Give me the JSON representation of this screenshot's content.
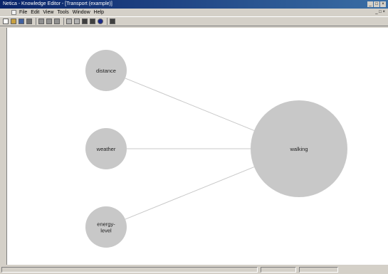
{
  "window": {
    "title": "Netica - Knowledge Editor - [Transport (example)]",
    "controls": [
      "_",
      "□",
      "×"
    ]
  },
  "menubar": {
    "items": [
      "File",
      "Edit",
      "View",
      "Tools",
      "Window",
      "Help"
    ],
    "mdi_controls": "_ □ ×"
  },
  "toolbar": {
    "buttons": [
      {
        "name": "new-icon",
        "color": "#ffffff"
      },
      {
        "name": "open-icon",
        "color": "#c8a040"
      },
      {
        "name": "save-icon",
        "color": "#4060a0"
      },
      {
        "name": "print-icon",
        "color": "#707070"
      },
      {
        "name": "separator"
      },
      {
        "name": "cut-icon",
        "color": "#909090"
      },
      {
        "name": "copy-icon",
        "color": "#909090"
      },
      {
        "name": "paste-icon",
        "color": "#909090"
      },
      {
        "name": "separator"
      },
      {
        "name": "node-icon",
        "color": "#b0b0b0"
      },
      {
        "name": "link-icon",
        "color": "#b0b0b0"
      },
      {
        "name": "arrow-left-icon",
        "color": "#404040"
      },
      {
        "name": "arrow-right-icon",
        "color": "#404040"
      },
      {
        "name": "dot-icon",
        "color": "#1a2a8a"
      },
      {
        "name": "separator"
      },
      {
        "name": "network-icon",
        "color": "#404040"
      }
    ]
  },
  "network": {
    "nodes": [
      {
        "id": "distance",
        "label": [
          "distance"
        ]
      },
      {
        "id": "weather",
        "label": [
          "weather"
        ]
      },
      {
        "id": "energy-level",
        "label": [
          "energy-",
          "level"
        ]
      },
      {
        "id": "walking",
        "label": [
          "walking"
        ]
      }
    ],
    "links": [
      {
        "from": "distance",
        "to": "walking"
      },
      {
        "from": "weather",
        "to": "walking"
      },
      {
        "from": "energy-level",
        "to": "walking"
      }
    ],
    "colors": {
      "node_fill": "#c8c8c8",
      "link": "#c8c8c8",
      "background": "#ffffff"
    }
  },
  "statusbar": {
    "panes": [
      "",
      "",
      ""
    ]
  }
}
